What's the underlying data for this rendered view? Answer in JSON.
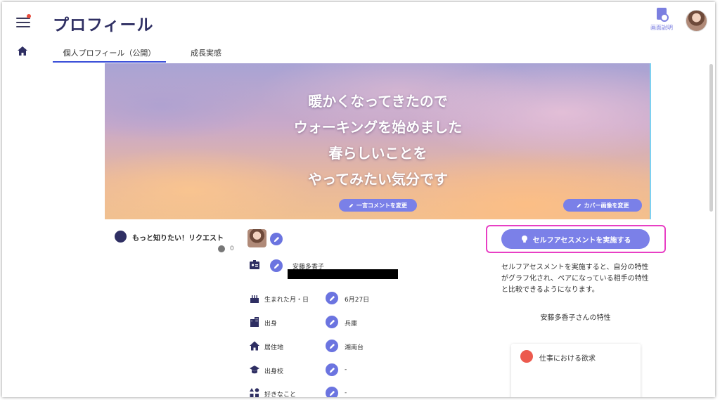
{
  "header": {
    "title": "プロフィール",
    "help_label": "画面説明"
  },
  "tabs": [
    {
      "label": "個人プロフィール（公開）",
      "active": true
    },
    {
      "label": "成長実感",
      "active": false
    }
  ],
  "cover": {
    "lines": [
      "暖かくなってきたので",
      "ウォーキングを始めました",
      "春らしいことを",
      "やってみたい気分です"
    ],
    "comment_button": "一言コメントを変更",
    "cover_button": "カバー画像を変更"
  },
  "request": {
    "label": "もっと知りたい！リクエスト",
    "count": "0"
  },
  "profile": {
    "name": "安藤多香子",
    "fields": [
      {
        "label": "生まれた月・日",
        "value": "6月27日",
        "icon": "cake-icon"
      },
      {
        "label": "出身",
        "value": "兵庫",
        "icon": "building-icon"
      },
      {
        "label": "居住地",
        "value": "湘南台",
        "icon": "home-icon"
      },
      {
        "label": "出身校",
        "value": "-",
        "icon": "graduation-cap-icon"
      },
      {
        "label": "好きなこと",
        "value": "-",
        "icon": "shapes-icon"
      }
    ]
  },
  "assessment": {
    "button_label": "セルフアセスメントを実施する",
    "description": "セルフアセスメントを実施すると、自分の特性がグラフ化され、ペアになっている相手の特性と比較できるようになります。",
    "trait_title": "安藤多香子さんの特性",
    "card_title": "仕事における欲求"
  },
  "colors": {
    "accent": "#7b80e8",
    "title": "#2f2f63",
    "highlight": "#e83fc4",
    "tab_underline": "#3b4fd8"
  }
}
